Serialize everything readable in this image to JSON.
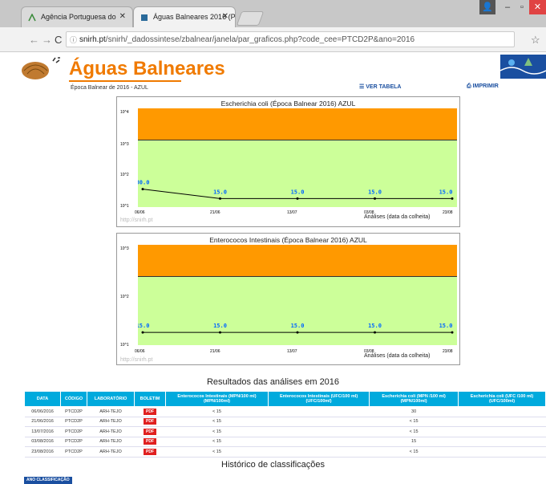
{
  "browser": {
    "tabs": [
      {
        "label": "Agência Portuguesa do"
      },
      {
        "label": "Águas Balneares 2016 (P"
      }
    ],
    "url_host": "snirh.pt",
    "url_path": "/snirh/_dadossintese/zbalnear/janela/par_graficos.php?code_cee=PTCD2P&ano=2016"
  },
  "header": {
    "brand": "Águas Balneares",
    "season": "Época Balnear de 2016 - AZUL",
    "view_table": "VER TABELA",
    "print": "IMPRIMIR"
  },
  "chart_data": [
    {
      "type": "line",
      "title": "Escherichia coli (Época Balnear 2016)   AZUL",
      "y_scale": "log",
      "y_ticks": [
        "10^4",
        "10^3",
        "10^2",
        "10^1"
      ],
      "x_ticks": [
        "06/06",
        "21/06",
        "13/07",
        "03/08",
        "23/08"
      ],
      "x": [
        "06/06",
        "21/06",
        "13/07",
        "03/08",
        "23/08"
      ],
      "values": [
        30.0,
        15.0,
        15.0,
        15.0,
        15.0
      ],
      "value_labels": [
        "30.0",
        "15.0",
        "15.0",
        "15.0",
        "15.0"
      ],
      "xlabel": "Análises (data da colheita)",
      "watermark": "http://snirh.pt",
      "colors": {
        "band_upper": "#ff9900",
        "band_lower": "#ccff99",
        "value": "#0066ff"
      }
    },
    {
      "type": "line",
      "title": "Enterococos Intestinais (Época Balnear 2016)   AZUL",
      "y_scale": "log",
      "y_ticks": [
        "10^3",
        "10^2",
        "10^1"
      ],
      "x_ticks": [
        "06/06",
        "21/06",
        "13/07",
        "03/08",
        "23/08"
      ],
      "x": [
        "06/06",
        "21/06",
        "13/07",
        "03/08",
        "23/08"
      ],
      "values": [
        15.0,
        15.0,
        15.0,
        15.0,
        15.0
      ],
      "value_labels": [
        "15.0",
        "15.0",
        "15.0",
        "15.0",
        "15.0"
      ],
      "xlabel": "Análises (data da colheita)",
      "watermark": "http://snirh.pt",
      "colors": {
        "band_upper": "#ff9900",
        "band_lower": "#ccff99",
        "value": "#0066ff"
      }
    }
  ],
  "results": {
    "title": "Resultados das análises em 2016",
    "headers": [
      "DATA",
      "CÓDIGO",
      "LABORATÓRIO",
      "BOLETIM",
      "Enterococos Intestinais (MPN/100 ml) (MPN/100ml)",
      "Enterococos Intestinais (UFC/100 ml) (UFC/100ml)",
      "Escherichia coli (MPN /100 ml) (MPN/100ml)",
      "Escherichia coli (UFC /100 ml) (UFC/100ml)"
    ],
    "rows": [
      {
        "date": "06/06/2016",
        "code": "PTCD2P",
        "lab": "ARH-TEJO",
        "pdf": "PDF",
        "ent_mpn": "< 15",
        "ent_ufc": "",
        "ecoli_mpn": "30",
        "ecoli_ufc": ""
      },
      {
        "date": "21/06/2016",
        "code": "PTCD2P",
        "lab": "ARH-TEJO",
        "pdf": "PDF",
        "ent_mpn": "< 15",
        "ent_ufc": "",
        "ecoli_mpn": "< 15",
        "ecoli_ufc": ""
      },
      {
        "date": "13/07/2016",
        "code": "PTCD2P",
        "lab": "ARH-TEJO",
        "pdf": "PDF",
        "ent_mpn": "< 15",
        "ent_ufc": "",
        "ecoli_mpn": "< 15",
        "ecoli_ufc": ""
      },
      {
        "date": "03/08/2016",
        "code": "PTCD2P",
        "lab": "ARH-TEJO",
        "pdf": "PDF",
        "ent_mpn": "< 15",
        "ent_ufc": "",
        "ecoli_mpn": "15",
        "ecoli_ufc": ""
      },
      {
        "date": "23/08/2016",
        "code": "PTCD2P",
        "lab": "ARH-TEJO",
        "pdf": "PDF",
        "ent_mpn": "< 15",
        "ent_ufc": "",
        "ecoli_mpn": "< 15",
        "ecoli_ufc": ""
      }
    ]
  },
  "history": {
    "title": "Histórico de classificações",
    "button": "ANO CLASSIFICAÇÃO"
  }
}
